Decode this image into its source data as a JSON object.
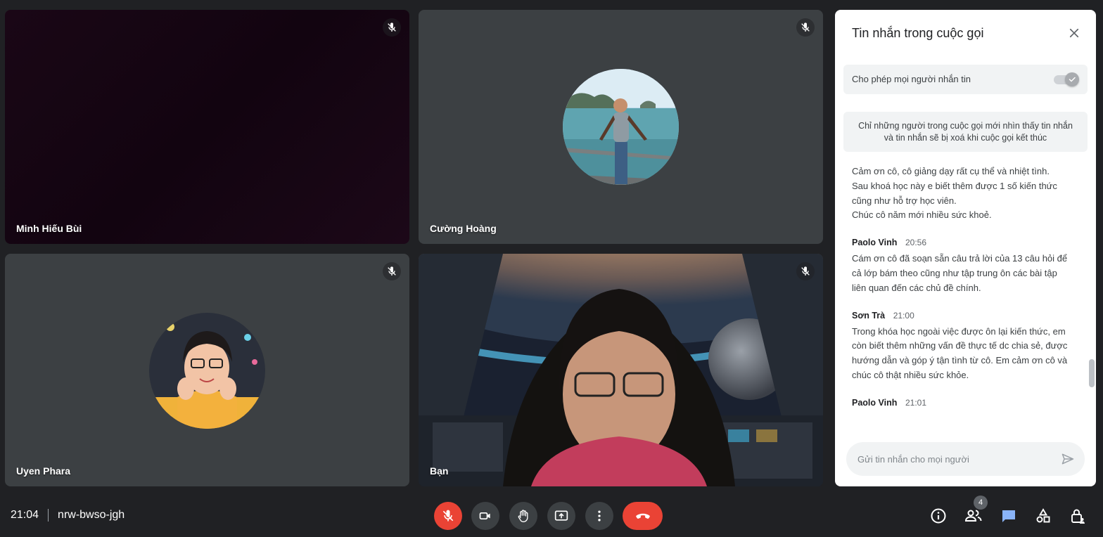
{
  "meeting": {
    "time": "21:04",
    "code": "nrw-bwso-jgh"
  },
  "participants": [
    {
      "name": "Minh Hiếu Bùi"
    },
    {
      "name": "Cường Hoàng"
    },
    {
      "name": "Uyen Phara"
    },
    {
      "name": "Bạn"
    }
  ],
  "chat": {
    "title": "Tin nhắn trong cuộc gọi",
    "allow_label": "Cho phép mọi người nhắn tin",
    "allow_enabled": true,
    "notice_line1": "Chỉ những người trong cuộc gọi mới nhìn thấy tin nhắn",
    "notice_line2": "và tin nhắn sẽ bị xoá khi cuộc gọi kết thúc",
    "messages": [
      {
        "sender": "",
        "time": "",
        "lines": [
          "Cảm ơn cô, cô giảng dạy rất cụ thể và nhiệt tình.",
          "Sau khoá học này e biết thêm được 1 số kiến thức",
          "cũng như hỗ trợ học viên.",
          "Chúc cô năm mới nhiều sức khoẻ."
        ]
      },
      {
        "sender": "Paolo Vinh",
        "time": "20:56",
        "lines": [
          "Cám ơn cô đã soạn sẵn câu trả lời của 13 câu hỏi để",
          "cả lớp bám theo cũng như tập trung ôn các bài tập",
          "liên quan đến các chủ đề chính."
        ]
      },
      {
        "sender": "Sơn Trà",
        "time": "21:00",
        "lines": [
          "Trong khóa học ngoài việc được ôn lại kiến thức, em",
          "còn biết thêm những vấn đề thực tế dc chia sẻ, được",
          "hướng dẫn và góp ý tận tình từ cô. Em cảm ơn cô và",
          "chúc cô thật nhiều sức khỏe."
        ]
      },
      {
        "sender": "Paolo Vinh",
        "time": "21:01",
        "lines": []
      }
    ],
    "input_placeholder": "Gửi tin nhắn cho mọi người"
  },
  "people_count": "4",
  "icons": {
    "mic_off": "mic-off-icon",
    "camera": "camera-icon",
    "raise_hand": "hand-icon",
    "present": "present-screen-icon",
    "more": "more-vert-icon",
    "end_call": "call-end-icon",
    "info": "info-icon",
    "people": "people-icon",
    "chat": "chat-icon",
    "activities": "activities-icon",
    "host_controls": "lock-person-icon"
  },
  "colors": {
    "end_call": "#ea4335",
    "chat_active": "#8ab4f8",
    "panel_bg": "#ffffff"
  }
}
